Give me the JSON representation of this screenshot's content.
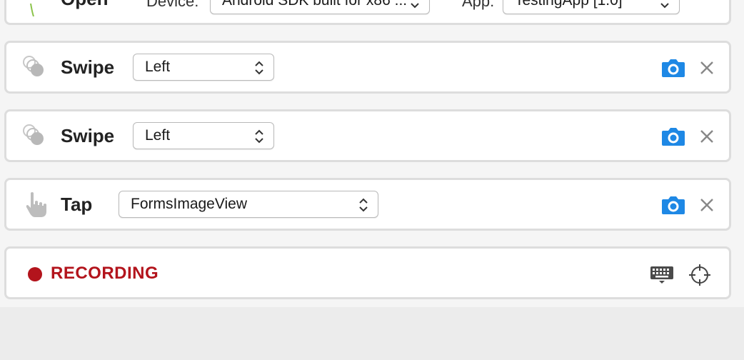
{
  "colors": {
    "accent_blue": "#1e88e5",
    "recording_red": "#b3141c",
    "icon_gray": "#b8b8b8"
  },
  "open_step": {
    "name": "Open",
    "device_label": "Device:",
    "device_value": "Android SDK built for x86 ...",
    "app_label": "App:",
    "app_value": "TestingApp [1.0]"
  },
  "steps": [
    {
      "name": "Swipe",
      "icon": "swipe-icon",
      "select_value": "Left"
    },
    {
      "name": "Swipe",
      "icon": "swipe-icon",
      "select_value": "Left"
    },
    {
      "name": "Tap",
      "icon": "tap-hand-icon",
      "select_value": "FormsImageView"
    }
  ],
  "recording": {
    "label": "RECORDING",
    "icons": [
      "keyboard-icon",
      "crosshair-icon"
    ]
  }
}
